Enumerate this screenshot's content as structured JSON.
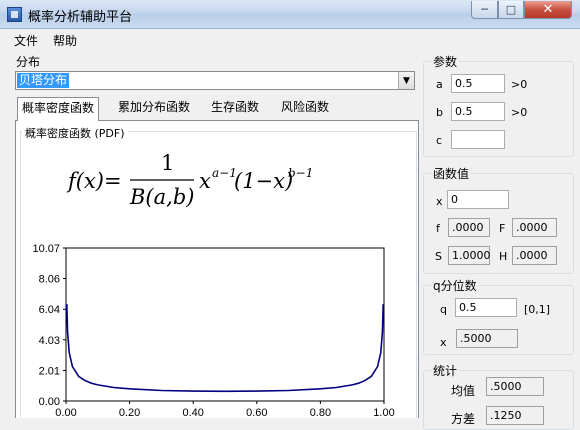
{
  "window": {
    "title": "概率分析辅助平台",
    "close_glyph": "✕",
    "min_glyph": "─",
    "max_glyph": "□"
  },
  "menu": {
    "items": [
      "文件",
      "帮助"
    ]
  },
  "distribution": {
    "label": "分布",
    "selected": "贝塔分布",
    "arrow": "▼"
  },
  "tabs": [
    "概率密度函数",
    "累加分布函数",
    "生存函数",
    "风险函数"
  ],
  "pdf": {
    "legend": "概率密度函数 (PDF)",
    "formula": {
      "lhs": "f(x)=",
      "numerator": "1",
      "denominator": "B(a,b)",
      "rhs_x": "x",
      "rhs_x_exp": "a−1",
      "rhs_paren": "(1−x)",
      "rhs_paren_exp": "b−1"
    }
  },
  "params": {
    "legend": "参数",
    "a": {
      "label": "a",
      "value": "0.5",
      "note": ">0"
    },
    "b": {
      "label": "b",
      "value": "0.5",
      "note": ">0"
    },
    "c": {
      "label": "c",
      "value": ""
    }
  },
  "funcvals": {
    "legend": "函数值",
    "x": {
      "label": "x",
      "value": "0"
    },
    "f": {
      "label": "f",
      "value": ".0000"
    },
    "F": {
      "label": "F",
      "value": ".0000"
    },
    "S": {
      "label": "S",
      "value": "1.0000"
    },
    "H": {
      "label": "H",
      "value": ".0000"
    }
  },
  "quantile": {
    "legend": "q分位数",
    "q": {
      "label": "q",
      "value": "0.5",
      "note": "[0,1]"
    },
    "x": {
      "label": "x",
      "value": ".5000"
    }
  },
  "stats": {
    "legend": "统计",
    "mean": {
      "label": "均值",
      "value": ".5000"
    },
    "variance": {
      "label": "方差",
      "value": ".1250"
    }
  },
  "chart_data": {
    "type": "line",
    "title": "",
    "xlabel": "",
    "ylabel": "",
    "xlim": [
      0,
      1
    ],
    "ylim": [
      0,
      10.07
    ],
    "x_ticks": [
      "0.00",
      "0.20",
      "0.40",
      "0.60",
      "0.80",
      "1.00"
    ],
    "y_ticks": [
      "0.00",
      "2.01",
      "4.03",
      "6.04",
      "8.06",
      "10.07"
    ],
    "series_color": "#000080",
    "x": [
      0.0025,
      0.005,
      0.01,
      0.02,
      0.04,
      0.06,
      0.08,
      0.1,
      0.15,
      0.2,
      0.3,
      0.4,
      0.5,
      0.6,
      0.7,
      0.8,
      0.85,
      0.9,
      0.92,
      0.94,
      0.96,
      0.98,
      0.99,
      0.995,
      0.9975
    ],
    "y": [
      6.38,
      4.52,
      3.2,
      2.27,
      1.62,
      1.34,
      1.17,
      1.06,
      0.89,
      0.8,
      0.69,
      0.65,
      0.64,
      0.65,
      0.69,
      0.8,
      0.89,
      1.06,
      1.17,
      1.34,
      1.62,
      2.27,
      3.2,
      4.52,
      6.38
    ],
    "grid": false,
    "legend": "none"
  }
}
